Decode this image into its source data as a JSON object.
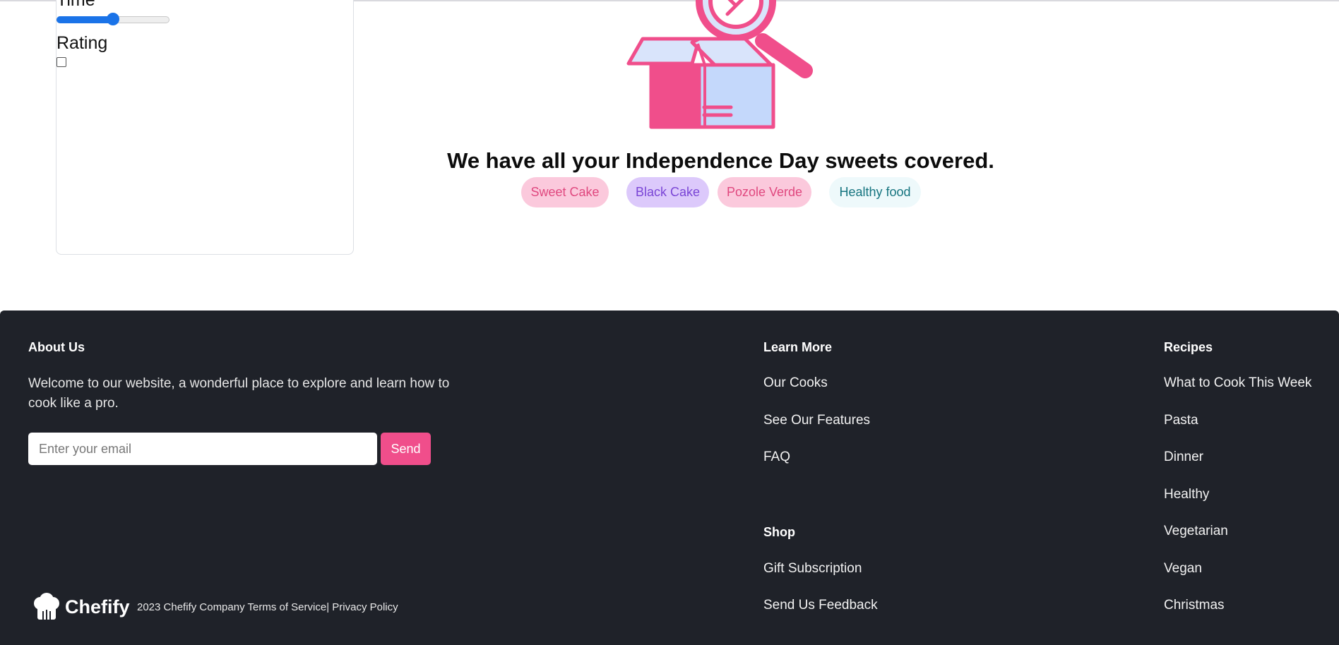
{
  "filters": {
    "time_heading": "Time",
    "time_slider_value": 0.5,
    "rating_heading": "Rating",
    "rating_checked": false
  },
  "empty_state": {
    "title": "We have all your Independence Day sweets covered.",
    "tags": [
      {
        "label": "Sweet Cake",
        "bg": "#fbc9dc",
        "color": "#e0487f"
      },
      {
        "label": "Black Cake",
        "bg": "#dcc9fb",
        "color": "#7a45d6"
      },
      {
        "label": "Pozole Verde",
        "bg": "#fbc9dc",
        "color": "#e0487f"
      },
      {
        "label": "Healthy food",
        "bg": "#eef9fb",
        "color": "#15747f"
      }
    ]
  },
  "footer": {
    "about": {
      "heading": "About Us",
      "text": "Welcome to our website, a wonderful place to explore and learn how to cook like a pro.",
      "email_placeholder": "Enter your email",
      "send_label": "Send"
    },
    "learn_more": {
      "heading": "Learn More",
      "links": [
        "Our Cooks",
        "See Our Features",
        "FAQ"
      ]
    },
    "shop": {
      "heading": "Shop",
      "links": [
        "Gift Subscription",
        "Send Us Feedback"
      ]
    },
    "recipes": {
      "heading": "Recipes",
      "links": [
        "What to Cook This Week",
        "Pasta",
        "Dinner",
        "Healthy",
        "Vegetarian",
        "Vegan",
        "Christmas"
      ]
    },
    "brand": {
      "name": "Chefify",
      "copyright": "2023 Chefify Company",
      "terms": "Terms of Service|",
      "privacy": "Privacy Policy"
    }
  },
  "colors": {
    "accent": "#f04e8b",
    "footer_bg": "#1f2229",
    "slider": "#1a73e8"
  }
}
